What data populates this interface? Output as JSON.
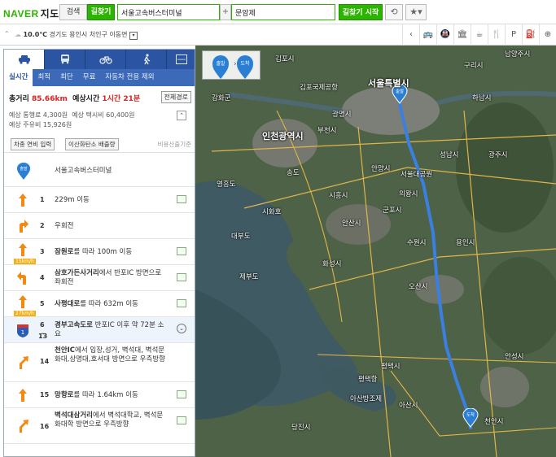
{
  "header": {
    "logo": "NAVER",
    "logo_sub": "지도",
    "tab_search": "검색",
    "tab_directions": "길찾기",
    "origin": "서울고속버스터미널",
    "destination": "문암제",
    "plus": "+",
    "start_button": "길찾기 시작",
    "refresh_icon": "refresh-icon",
    "star_icon": "star-icon"
  },
  "weather": {
    "temp": "10.0℃",
    "location": "경기도 용인시 처인구 이동면",
    "categories": [
      "bus-icon",
      "subway-icon",
      "bank-icon",
      "cafe-icon",
      "restaurant-icon",
      "parking-icon",
      "gas-icon",
      "more-icon"
    ]
  },
  "panel": {
    "modes": [
      "car-icon",
      "bus-icon",
      "bicycle-icon",
      "walk-icon"
    ],
    "minimize": "—",
    "options": [
      "실시간",
      "최적",
      "최단",
      "무료",
      "자동차 전용 제외"
    ],
    "summary": {
      "total_label": "총거리",
      "total_value": "85.66km",
      "time_label": "예상시간",
      "time_value": "1시간 21분",
      "full_route": "전체경로",
      "toll_label": "예상 통행료",
      "toll_value": "4,300원",
      "taxi_label": "예상 택시비",
      "taxi_value": "60,400원",
      "fuel_label": "예상 주유비",
      "fuel_value": "15,926원",
      "btn_fuel": "차종 연비 입력",
      "btn_co2": "이산화탄소 배출량",
      "calc_note": "비용산출기준"
    },
    "start": {
      "label": "출발",
      "text": "서울고속버스터미널"
    },
    "steps": [
      {
        "num": "1",
        "text": "229m 이동",
        "bold": ""
      },
      {
        "num": "2",
        "text": "우회전",
        "bold": ""
      },
      {
        "num": "3",
        "bold": "잠원로",
        "text": "를 따라 100m 이동",
        "badge": "15km/h"
      },
      {
        "num": "4",
        "bold": "삼호가든사거리",
        "text": "에서 반포IC 방면으로 좌회전"
      },
      {
        "num": "5",
        "bold": "사평대로",
        "text": "를 따라 632m 이동",
        "badge": "27km/h"
      },
      {
        "num": "6",
        "num2": "13",
        "bold": "경부고속도로",
        "text": " 반포IC 이후 약 72분 소요",
        "shield": "1"
      },
      {
        "num": "14",
        "bold": "천안IC",
        "text": "에서 입장,성거, 벽석대, 벽석문화대,상명대,호서대 방면으로 우측방향"
      },
      {
        "num": "15",
        "bold": "망향로",
        "text": "를 따라 1.64km 이동"
      },
      {
        "num": "16",
        "bold": "벽석대삼거리",
        "text": "에서 벽석대학교, 벽석문화대학 방면으로 우측방향"
      }
    ]
  },
  "map": {
    "legend_start": "출발",
    "legend_end": "도착",
    "marker_start": "출발",
    "marker_end": "도착",
    "labels": [
      {
        "t": "서울특별시",
        "c": "big"
      },
      {
        "t": "인천광역시",
        "c": "big"
      },
      {
        "t": "김포국제공항",
        "c": ""
      },
      {
        "t": "김포시",
        "c": ""
      },
      {
        "t": "부천시",
        "c": ""
      },
      {
        "t": "안양시",
        "c": ""
      },
      {
        "t": "성남시",
        "c": ""
      },
      {
        "t": "하남시",
        "c": ""
      },
      {
        "t": "구리시",
        "c": ""
      },
      {
        "t": "남양주시",
        "c": ""
      },
      {
        "t": "광명시",
        "c": ""
      },
      {
        "t": "시흥시",
        "c": ""
      },
      {
        "t": "안산시",
        "c": ""
      },
      {
        "t": "군포시",
        "c": ""
      },
      {
        "t": "의왕시",
        "c": ""
      },
      {
        "t": "수원시",
        "c": ""
      },
      {
        "t": "용인시",
        "c": ""
      },
      {
        "t": "화성시",
        "c": ""
      },
      {
        "t": "오산시",
        "c": ""
      },
      {
        "t": "평택시",
        "c": ""
      },
      {
        "t": "안성시",
        "c": ""
      },
      {
        "t": "천안시",
        "c": ""
      },
      {
        "t": "아산시",
        "c": ""
      },
      {
        "t": "당진시",
        "c": ""
      },
      {
        "t": "시화호",
        "c": ""
      },
      {
        "t": "대부도",
        "c": ""
      },
      {
        "t": "제부도",
        "c": ""
      },
      {
        "t": "아산방조제",
        "c": ""
      },
      {
        "t": "평택항",
        "c": ""
      },
      {
        "t": "강화군",
        "c": ""
      },
      {
        "t": "영흥도",
        "c": ""
      },
      {
        "t": "서울대공원",
        "c": ""
      },
      {
        "t": "광주시",
        "c": ""
      },
      {
        "t": "송도",
        "c": ""
      }
    ]
  }
}
